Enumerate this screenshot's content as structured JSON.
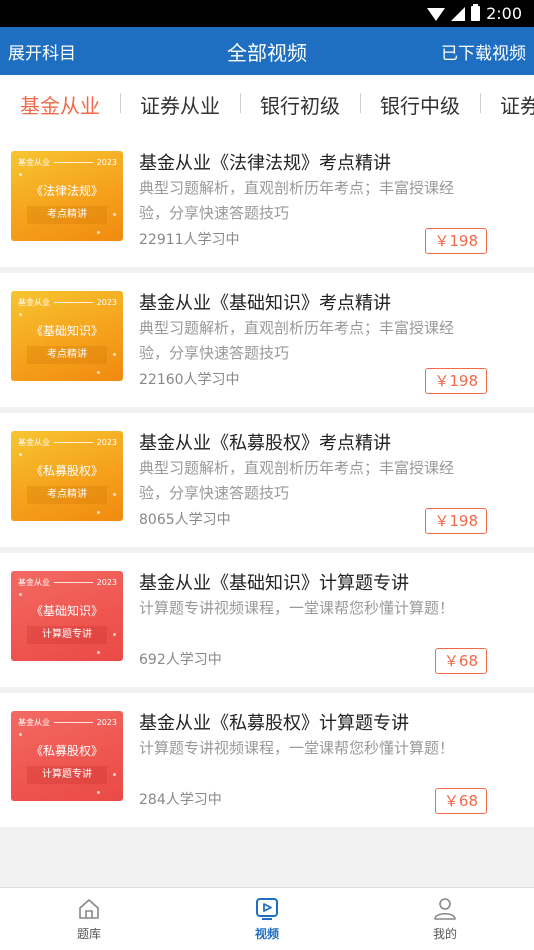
{
  "status_bar": {
    "time": "2:00"
  },
  "nav": {
    "left": "展开科目",
    "title": "全部视频",
    "right": "已下载视频"
  },
  "tabs": [
    "基金从业",
    "证券从业",
    "银行初级",
    "银行中级",
    "证券"
  ],
  "courses": [
    {
      "thumb_top": "基金从业",
      "thumb_year": "2023",
      "thumb_subject": "《法律法规》",
      "thumb_band": "考点精讲",
      "thumb_style": "orange",
      "title": "基金从业《法律法规》考点精讲",
      "desc": "典型习题解析，直观剖析历年考点；丰富授课经验，分享快速答题技巧",
      "count": "22911人学习中",
      "price": "￥198"
    },
    {
      "thumb_top": "基金从业",
      "thumb_year": "2023",
      "thumb_subject": "《基础知识》",
      "thumb_band": "考点精讲",
      "thumb_style": "orange",
      "title": "基金从业《基础知识》考点精讲",
      "desc": "典型习题解析，直观剖析历年考点；丰富授课经验，分享快速答题技巧",
      "count": "22160人学习中",
      "price": "￥198"
    },
    {
      "thumb_top": "基金从业",
      "thumb_year": "2023",
      "thumb_subject": "《私募股权》",
      "thumb_band": "考点精讲",
      "thumb_style": "orange",
      "title": "基金从业《私募股权》考点精讲",
      "desc": "典型习题解析，直观剖析历年考点；丰富授课经验，分享快速答题技巧",
      "count": "8065人学习中",
      "price": "￥198"
    },
    {
      "thumb_top": "基金从业",
      "thumb_year": "2023",
      "thumb_subject": "《基础知识》",
      "thumb_band": "计算题专讲",
      "thumb_style": "red",
      "title": "基金从业《基础知识》计算题专讲",
      "desc": "计算题专讲视频课程，一堂课帮您秒懂计算题！",
      "count": "692人学习中",
      "price": "￥68"
    },
    {
      "thumb_top": "基金从业",
      "thumb_year": "2023",
      "thumb_subject": "《私募股权》",
      "thumb_band": "计算题专讲",
      "thumb_style": "red",
      "title": "基金从业《私募股权》计算题专讲",
      "desc": "计算题专讲视频课程，一堂课帮您秒懂计算题！",
      "count": "284人学习中",
      "price": "￥68"
    }
  ],
  "bottom_nav": [
    {
      "label": "题库",
      "icon": "home-icon"
    },
    {
      "label": "视频",
      "icon": "video-icon",
      "active": true
    },
    {
      "label": "我的",
      "icon": "user-icon"
    }
  ],
  "colors": {
    "primary": "#1e6fc2",
    "accent": "#f06a4a",
    "thumb_orange": "#f6a21c",
    "thumb_red": "#ef554f"
  }
}
